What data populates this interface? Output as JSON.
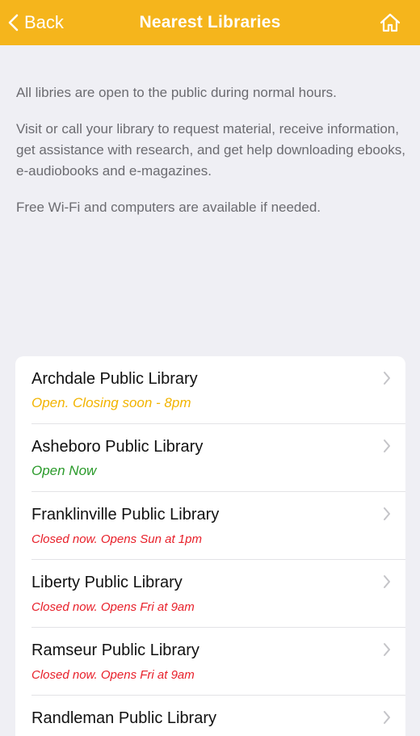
{
  "navbar": {
    "back_label": "Back",
    "title": "Nearest Libraries",
    "back_icon": "chevron-left-icon",
    "home_icon": "home-icon"
  },
  "intro": {
    "paragraphs": [
      "All libries are open to the public during normal hours.",
      "Visit or call your library to request material, receive information, get assistance with research, and get help downloading ebooks, e-audiobooks and e-magazines.",
      "Free Wi-Fi and computers are available if needed."
    ]
  },
  "colors": {
    "accent": "#f5b51c",
    "status_closing": "#f2b400",
    "status_open": "#2a9a2a",
    "status_closed": "#e8202a"
  },
  "libraries": [
    {
      "name": "Archdale Public Library",
      "status": "Open. Closing soon - 8pm",
      "status_kind": "closing"
    },
    {
      "name": "Asheboro Public Library",
      "status": "Open Now",
      "status_kind": "open"
    },
    {
      "name": "Franklinville Public Library",
      "status": "Closed now. Opens Sun at 1pm",
      "status_kind": "closed"
    },
    {
      "name": "Liberty Public Library",
      "status": "Closed now. Opens Fri at 9am",
      "status_kind": "closed"
    },
    {
      "name": "Ramseur Public Library",
      "status": "Closed now. Opens Fri at 9am",
      "status_kind": "closed"
    },
    {
      "name": "Randleman Public Library",
      "status": "",
      "status_kind": ""
    }
  ]
}
